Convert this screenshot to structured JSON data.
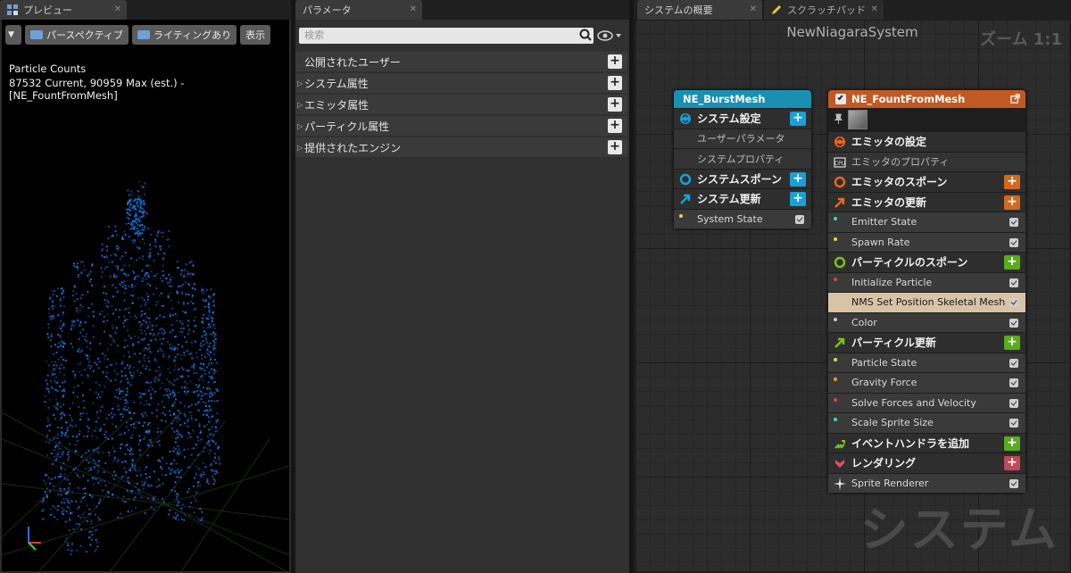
{
  "tabs": {
    "preview": "プレビュー",
    "params": "パラメータ",
    "overview": "システムの概要",
    "scratch": "スクラッチパッド"
  },
  "preview": {
    "toolbar": [
      "パースペクティブ",
      "ライティングあり",
      "表示"
    ],
    "particle_title": "Particle Counts",
    "particle_line": "87532 Current, 90959 Max (est.) - [NE_FountFromMesh]"
  },
  "params": {
    "search_placeholder": "検索",
    "rows": [
      "公開されたユーザー",
      "システム属性",
      "エミッタ属性",
      "パーティクル属性",
      "提供されたエンジン"
    ]
  },
  "graph": {
    "title": "NewNiagaraSystem",
    "zoom": "ズーム 1:1",
    "watermark": "システム",
    "burst": {
      "name": "NE_BurstMesh",
      "items": [
        {
          "type": "section",
          "label": "システム設定",
          "icon": "system-settings-icon",
          "color": "#1a9fd6",
          "add": true
        },
        {
          "type": "sub",
          "label": "ユーザーパラメータ"
        },
        {
          "type": "sub",
          "label": "システムプロパティ"
        },
        {
          "type": "section",
          "label": "システムスポーン",
          "icon": "spawn-ring-icon",
          "color": "#1a9fd6",
          "add": true
        },
        {
          "type": "section",
          "label": "システム更新",
          "icon": "update-arrow-icon",
          "color": "#1a9fd6",
          "add": true
        },
        {
          "type": "module",
          "label": "System State",
          "dot": "#e8d83a",
          "check": true
        }
      ]
    },
    "fount": {
      "name": "NE_FountFromMesh",
      "items": [
        {
          "type": "section",
          "label": "エミッタの設定",
          "icon": "emitter-settings-icon",
          "color": "#e8661e"
        },
        {
          "type": "sub",
          "label": "エミッタのプロパティ",
          "icon": "cpu-icon"
        },
        {
          "type": "section",
          "label": "エミッタのスポーン",
          "icon": "spawn-ring-icon",
          "color": "#e8661e",
          "add": true
        },
        {
          "type": "section",
          "label": "エミッタの更新",
          "icon": "update-arrow-icon",
          "color": "#e8661e",
          "add": true
        },
        {
          "type": "module",
          "label": "Emitter State",
          "dot": "#3ad6d6",
          "check": true
        },
        {
          "type": "module",
          "label": "Spawn Rate",
          "dot": "#e8d83a",
          "check": true
        },
        {
          "type": "section",
          "label": "パーティクルのスポーン",
          "icon": "spawn-ring-icon",
          "color": "#7ac41e",
          "add": true
        },
        {
          "type": "module",
          "label": "Initialize Particle",
          "dot": "#e84040",
          "check": true
        },
        {
          "type": "module",
          "label": "NMS Set Position Skeletal Mesh",
          "selected": true,
          "check": true
        },
        {
          "type": "module",
          "label": "Color",
          "dot": "#cccccc",
          "check": true
        },
        {
          "type": "section",
          "label": "パーティクル更新",
          "icon": "update-arrow-icon",
          "color": "#7ac41e",
          "add": true
        },
        {
          "type": "module",
          "label": "Particle State",
          "dot": "#e8d83a",
          "check": true
        },
        {
          "type": "module",
          "label": "Gravity Force",
          "dot": "#e8a020",
          "check": true
        },
        {
          "type": "module",
          "label": "Solve Forces and Velocity",
          "dot": "#e84040",
          "check": true
        },
        {
          "type": "module",
          "label": "Scale Sprite Size",
          "dot": "#3ad6d6",
          "check": true
        },
        {
          "type": "section",
          "label": "イベントハンドラを追加",
          "icon": "event-handler-icon",
          "color": "#7ac41e",
          "add": true
        },
        {
          "type": "section",
          "label": "レンダリング",
          "icon": "render-icon",
          "color": "#e05060",
          "add": true
        },
        {
          "type": "module",
          "label": "Sprite Renderer",
          "icon": "sprite-burst-icon",
          "check": true
        }
      ]
    }
  },
  "colors": {
    "burst_header": "#1a8fb4",
    "fount_header": "#c05a22",
    "particle": "#1a78e8",
    "plus_blue": "#1a9fd6",
    "plus_orange": "#d2691e",
    "plus_green": "#5aaa1e",
    "plus_red": "#c04858"
  }
}
